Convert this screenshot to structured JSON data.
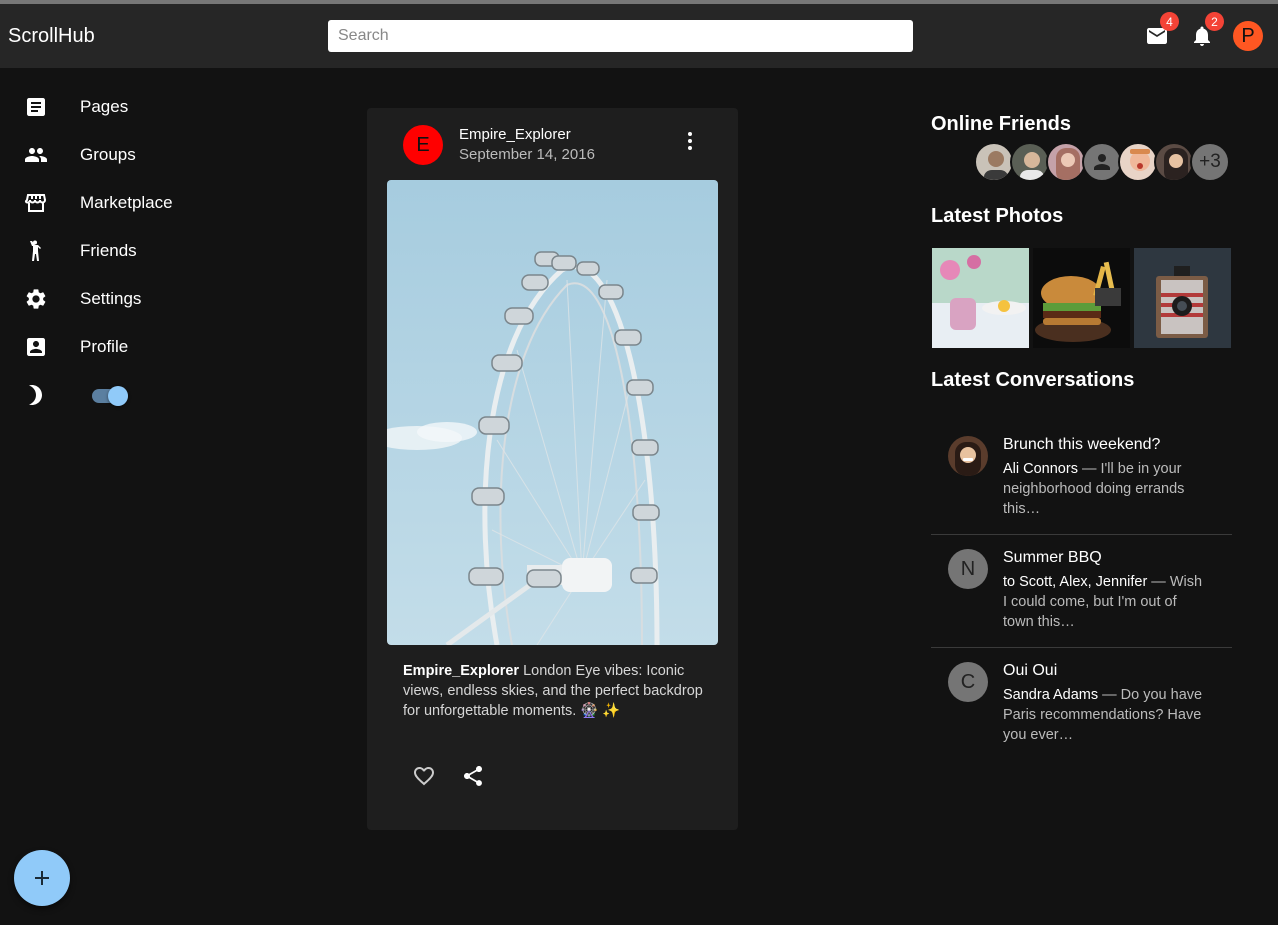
{
  "app": {
    "brand": "ScrollHub"
  },
  "search": {
    "placeholder": "Search"
  },
  "header": {
    "mail_badge": "4",
    "notifications_badge": "2",
    "user_initial": "P",
    "user_color": "#ff5722"
  },
  "sidebar": {
    "items": [
      {
        "label": "Pages",
        "icon": "article-icon"
      },
      {
        "label": "Groups",
        "icon": "people-icon"
      },
      {
        "label": "Marketplace",
        "icon": "storefront-icon"
      },
      {
        "label": "Friends",
        "icon": "person-waving-icon"
      },
      {
        "label": "Settings",
        "icon": "gear-icon"
      },
      {
        "label": "Profile",
        "icon": "account-box-icon"
      }
    ],
    "dark_mode": {
      "icon": "moon-icon",
      "enabled": true
    }
  },
  "post": {
    "author_initial": "E",
    "author": "Empire_Explorer",
    "date": "September 14, 2016",
    "image": "ferris-wheel-photo",
    "caption_author": "Empire_Explorer",
    "caption_text": " London Eye vibes: Iconic views, endless skies, and the perfect backdrop for unforgettable moments. 🎡 ✨"
  },
  "online_friends": {
    "title": "Online Friends",
    "extra_count": "+3"
  },
  "latest_photos": {
    "title": "Latest Photos"
  },
  "latest_conversations": {
    "title": "Latest Conversations",
    "items": [
      {
        "title": "Brunch this weekend?",
        "from": "Ali Connors",
        "preview": " — I'll be in your neighborhood doing errands this…",
        "initial": ""
      },
      {
        "title": "Summer BBQ",
        "from": "to Scott, Alex, Jennifer",
        "preview": " — Wish I could come, but I'm out of town this…",
        "initial": "N"
      },
      {
        "title": "Oui Oui",
        "from": "Sandra Adams",
        "preview": " — Do you have Paris recommendations? Have you ever…",
        "initial": "C"
      }
    ]
  },
  "colors": {
    "accent": "#90caf9",
    "badge": "#f44336",
    "post_avatar": "#ff0000"
  }
}
